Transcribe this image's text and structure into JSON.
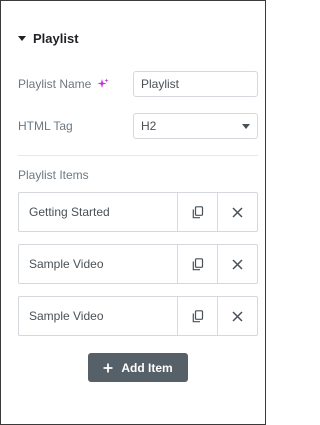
{
  "section": {
    "title": "Playlist",
    "expanded_icon": "caret-down-icon"
  },
  "fields": {
    "playlist_name": {
      "label": "Playlist Name",
      "value": "Playlist",
      "ai_icon": "sparkle-icon",
      "ai_color": "#c036e0"
    },
    "html_tag": {
      "label": "HTML Tag",
      "value": "H2"
    }
  },
  "items_label": "Playlist Items",
  "items": [
    {
      "title": "Getting Started"
    },
    {
      "title": "Sample Video"
    },
    {
      "title": "Sample Video"
    }
  ],
  "add_button": {
    "label": "Add Item",
    "icon": "plus-icon"
  },
  "colors": {
    "button_bg": "#556068",
    "border": "#d5d8dc",
    "label": "#6d7882",
    "title": "#1f2124"
  }
}
